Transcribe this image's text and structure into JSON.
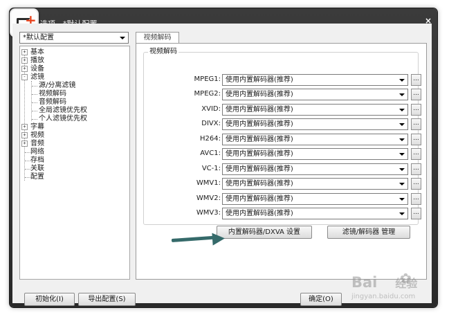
{
  "window": {
    "title": "选项 - *默认配置",
    "close_glyph": "×"
  },
  "profile": {
    "selected": "*默认配置"
  },
  "tree": {
    "items": [
      {
        "label": "基本",
        "toggle": "+"
      },
      {
        "label": "播放",
        "toggle": "+"
      },
      {
        "label": "设备",
        "toggle": "+"
      },
      {
        "label": "滤镜",
        "toggle": "-"
      },
      {
        "label": "源/分离滤镜"
      },
      {
        "label": "视频解码"
      },
      {
        "label": "音频解码"
      },
      {
        "label": "全局滤镜优先权"
      },
      {
        "label": "个人滤镜优先权"
      },
      {
        "label": "字幕",
        "toggle": "+"
      },
      {
        "label": "视频",
        "toggle": "+"
      },
      {
        "label": "音频",
        "toggle": "+"
      },
      {
        "label": "网络"
      },
      {
        "label": "存档"
      },
      {
        "label": "关联"
      },
      {
        "label": "配置"
      }
    ]
  },
  "tab": {
    "label": "视频解码"
  },
  "group": {
    "label": "视频解码"
  },
  "decoders": [
    {
      "label": "MPEG1:",
      "value": "使用内置解码器(推荐)"
    },
    {
      "label": "MPEG2:",
      "value": "使用内置解码器(推荐)"
    },
    {
      "label": "XVID:",
      "value": "使用内置解码器(推荐)"
    },
    {
      "label": "DIVX:",
      "value": "使用内置解码器(推荐)"
    },
    {
      "label": "H264:",
      "value": "使用内置解码器(推荐)"
    },
    {
      "label": "AVC1:",
      "value": "使用内置解码器(推荐)"
    },
    {
      "label": "VC-1:",
      "value": "使用内置解码器(推荐)"
    },
    {
      "label": "WMV1:",
      "value": "使用内置解码器(推荐)"
    },
    {
      "label": "WMV2:",
      "value": "使用内置解码器(推荐)"
    },
    {
      "label": "WMV3:",
      "value": "使用内置解码器(推荐)"
    }
  ],
  "dots_label": "...",
  "buttons": {
    "dxva": "内置解码器/DXVA 设置",
    "filter_manager": "滤镜/解码器 管理",
    "init": "初始化(I)",
    "export": "导出配置(S)",
    "ok": "确定(O)"
  },
  "watermark": {
    "brand": "Bai",
    "suffix": "经验",
    "url": "jingyan.baidu.com"
  },
  "colors": {
    "arrow": "#356a6a",
    "titlebar": "#333333"
  }
}
